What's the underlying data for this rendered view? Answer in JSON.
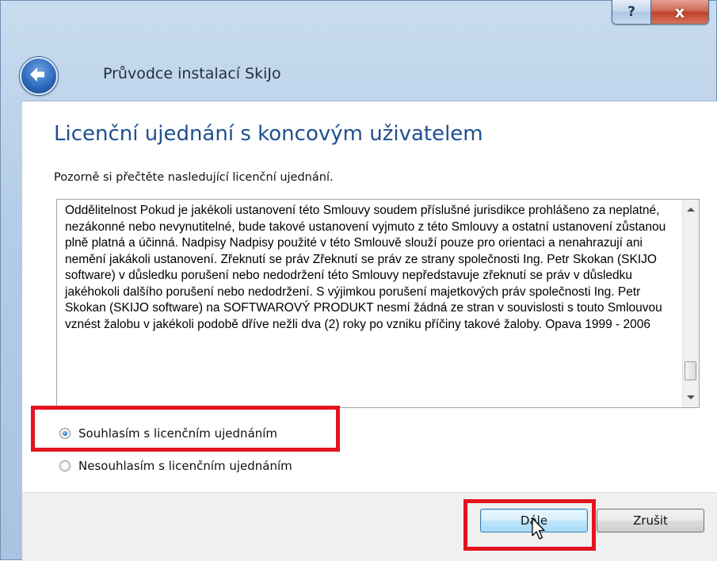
{
  "window": {
    "help_label": "?",
    "close_label": "x"
  },
  "wizard": {
    "title": "Průvodce instalací SkiJo"
  },
  "page": {
    "heading": "Licenční ujednání s koncovým uživatelem",
    "instruction": "Pozorně si přečtěte nasledující licenční ujednání.",
    "license_text": "Oddělitelnost Pokud je jakékoli ustanovení této Smlouvy soudem příslušné jurisdikce prohlášeno za neplatné, nezákonné nebo nevynutitelné, bude takové ustanovení vyjmuto z této Smlouvy a ostatní ustanovení zůstanou plně platná a účinná. Nadpisy Nadpisy použité v této Smlouvě slouží pouze pro orientaci a nenahrazují ani nemění jakákoli ustanovení. Zřeknutí se práv Zřeknutí se práv ze strany společnosti Ing. Petr Skokan (SKIJO software) v důsledku porušení nebo nedodržení této Smlouvy nepředstavuje zřeknutí se práv v důsledku jakéhokoli dalšího porušení nebo nedodržení. S výjimkou porušení majetkových práv společnosti Ing. Petr Skokan (SKIJO software) na SOFTWAROVÝ PRODUKT nesmí žádná ze stran v souvislosti s touto Smlouvou vznést žalobu v jakékoli podobě dříve nežli dva (2) roky po vzniku příčiny takové žaloby. Opava 1999 - 2006",
    "agree_label": "Souhlasím s licenčním ujednáním",
    "disagree_label": "Nesouhlasím s licenčním ujednáním",
    "agree_selected": true
  },
  "footer": {
    "next_label": "Dále",
    "cancel_label": "Zrušit"
  },
  "colors": {
    "heading": "#1f4f91",
    "highlight": "#e3141f"
  }
}
